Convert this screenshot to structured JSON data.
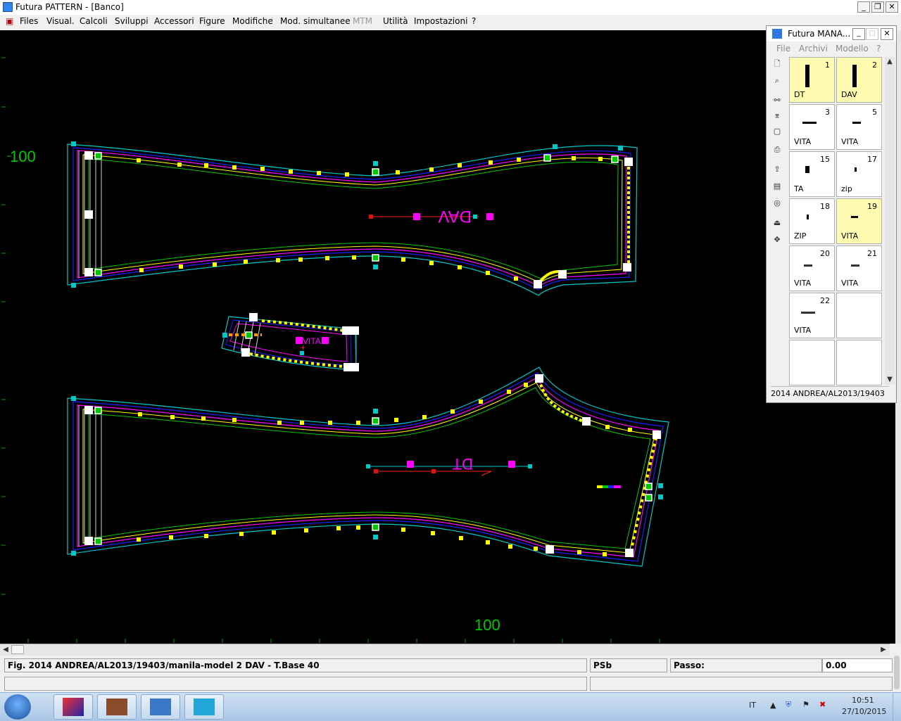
{
  "window": {
    "title": "Futura PATTERN - [Banco]"
  },
  "menu": {
    "items": [
      "Files",
      "Visual.",
      "Calcoli",
      "Sviluppi",
      "Accessori",
      "Figure",
      "Modifiche",
      "Mod. simultanee",
      "MTM",
      "Utilità",
      "Impostazioni",
      "?"
    ]
  },
  "canvas": {
    "ruler_label_left": "100",
    "ruler_label_bottom": "100",
    "piece_labels": {
      "dav": "DAV",
      "dt": "DT",
      "vita": "VITA"
    },
    "colors": {
      "background": "#000000",
      "ruler_text": "#00cc00",
      "outline_cyan": "#00c8c8",
      "outline_blue": "#1414ff",
      "outline_magenta": "#ff00ff",
      "outline_yellow": "#ffff00",
      "outline_green": "#00c800"
    }
  },
  "status": {
    "figure": "Fig. 2014 ANDREA/AL2013/19403/manila-model 2 DAV - T.Base 40",
    "psb": "PSb",
    "passo_label": "Passo:",
    "passo_value": "0.00"
  },
  "panel": {
    "title": "Futura MANA...",
    "menu": [
      "File",
      "Archivi",
      "Modello",
      "?"
    ],
    "cells": [
      {
        "num": "1",
        "label": "DT",
        "selected": true
      },
      {
        "num": "2",
        "label": "DAV",
        "selected": true
      },
      {
        "num": "3",
        "label": "VITA",
        "selected": false
      },
      {
        "num": "5",
        "label": "VITA",
        "selected": false
      },
      {
        "num": "15",
        "label": "TA",
        "selected": false
      },
      {
        "num": "17",
        "label": "zip",
        "selected": false
      },
      {
        "num": "18",
        "label": "ZIP",
        "selected": false
      },
      {
        "num": "19",
        "label": "VITA",
        "selected": true
      },
      {
        "num": "20",
        "label": "VITA",
        "selected": false
      },
      {
        "num": "21",
        "label": "VITA",
        "selected": false
      },
      {
        "num": "22",
        "label": "VITA",
        "selected": false
      },
      {
        "num": "",
        "label": "",
        "selected": false
      },
      {
        "num": "",
        "label": "",
        "selected": false
      },
      {
        "num": "",
        "label": "",
        "selected": false
      }
    ],
    "footer": "2014 ANDREA/AL2013/19403"
  },
  "taskbar": {
    "lang": "IT",
    "time": "10:51",
    "date": "27/10/2015"
  }
}
